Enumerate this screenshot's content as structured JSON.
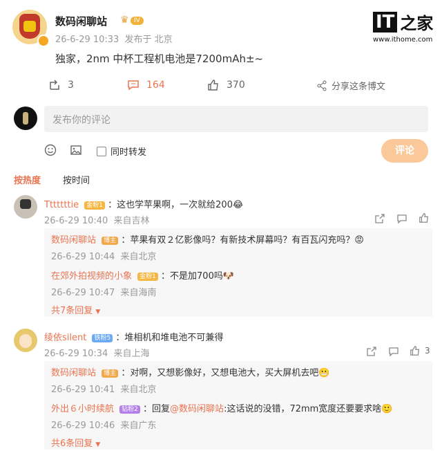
{
  "post": {
    "author": "数码闲聊站",
    "level_badge": "IV",
    "time": "26-6-29 10:33",
    "location": "发布于 北京",
    "text": "独家，2nm 中杯工程机电池是7200mAh±~",
    "reposts": "3",
    "comments": "164",
    "likes": "370",
    "share_label": "分享这条博文"
  },
  "logo": {
    "site": "www.ithome.com",
    "mark": "IT",
    "mark2": "之家"
  },
  "composer": {
    "placeholder": "发布你的评论",
    "repost_label": "同时转发",
    "submit_label": "评论"
  },
  "tabs": {
    "hot": "按热度",
    "time": "按时间"
  },
  "comments": [
    {
      "name": "Tttttttie",
      "badge": "金粉1",
      "text": "：这也学苹果啊，一次就给200",
      "emoji": "😂",
      "time": "26-6-29 10:40",
      "from": "来自吉林",
      "replies": [
        {
          "name": "数码闲聊站",
          "badge": "博主",
          "text": "：苹果有双２亿影像吗？有新技术屏幕吗？有百瓦闪充吗？",
          "emoji": "😡",
          "time": "26-6-29 10:44",
          "from": "来自北京"
        },
        {
          "name": "在郊外拍视频的小象",
          "badge": "金粉1",
          "text": "：不是加700吗",
          "emoji": "🐶",
          "time": "26-6-29 10:47",
          "from": "来自海南"
        }
      ],
      "more": "共7条回复"
    },
    {
      "name": "绫依silent",
      "badge": "铁粉5",
      "text": "：堆相机和堆电池不可兼得",
      "time": "26-6-29 10:34",
      "from": "来自上海",
      "likes": "3",
      "replies": [
        {
          "name": "数码闲聊站",
          "badge": "博主",
          "text": "：对啊，又想影像好，又想电池大，买大屏机去吧",
          "emoji": "😬",
          "time": "26-6-29 10:41",
          "from": "来自北京"
        },
        {
          "name": "外出６小时续航",
          "badge": "钻粉2",
          "text_prefix": "：回复",
          "mention": "@数码闲聊站",
          "text": ":这话说的没错，72mm宽度还要要求啥",
          "emoji": "🙂",
          "time": "26-6-29 10:46",
          "from": "来自广东"
        }
      ],
      "more": "共6条回复"
    }
  ]
}
